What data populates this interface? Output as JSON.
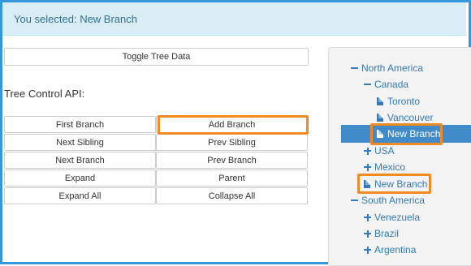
{
  "alert": {
    "text": "You selected: New Branch"
  },
  "toggle_button": "Toggle Tree Data",
  "api_label": "Tree Control API:",
  "buttons": {
    "first_branch": "First Branch",
    "add_branch": "Add Branch",
    "next_sibling": "Next Sibling",
    "prev_sibling": "Prev Sibling",
    "next_branch": "Next Branch",
    "prev_branch": "Prev Branch",
    "expand": "Expand",
    "parent": "Parent",
    "expand_all": "Expand All",
    "collapse_all": "Collapse All"
  },
  "tree": {
    "north_america": "North America",
    "canada": "Canada",
    "toronto": "Toronto",
    "vancouver": "Vancouver",
    "new_branch_canada": "New Branch",
    "usa": "USA",
    "mexico": "Mexico",
    "new_branch_na": "New Branch",
    "south_america": "South America",
    "venezuela": "Venezuela",
    "brazil": "Brazil",
    "argentina": "Argentina"
  },
  "colors": {
    "accent": "#337ab7",
    "highlight": "#f08a24",
    "selected": "#428bca",
    "frame": "#3498db"
  }
}
